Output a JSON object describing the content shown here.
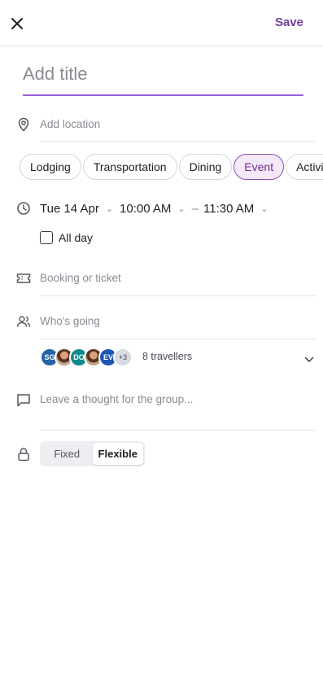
{
  "header": {
    "save_label": "Save"
  },
  "title_input": {
    "placeholder": "Add title",
    "value": ""
  },
  "location": {
    "placeholder": "Add location"
  },
  "categories": [
    {
      "label": "Lodging",
      "selected": false
    },
    {
      "label": "Transportation",
      "selected": false
    },
    {
      "label": "Dining",
      "selected": false
    },
    {
      "label": "Event",
      "selected": true
    },
    {
      "label": "Activity",
      "selected": false
    }
  ],
  "schedule": {
    "date": "Tue 14 Apr",
    "start": "10:00 AM",
    "separator": "–",
    "end": "11:30 AM"
  },
  "all_day": {
    "label": "All day",
    "checked": false
  },
  "booking": {
    "placeholder": "Booking or ticket"
  },
  "attendees": {
    "placeholder": "Who's going",
    "avatars": [
      {
        "initials": "SG",
        "color": "#2563a8"
      },
      {
        "initials": "",
        "color": "#8a5a44",
        "photo": true
      },
      {
        "initials": "DO",
        "color": "#0f8a8a"
      },
      {
        "initials": "",
        "color": "#b9865a",
        "photo": true
      },
      {
        "initials": "EV",
        "color": "#1e57b3"
      }
    ],
    "more_count": "+3",
    "count_label": "8 travellers"
  },
  "comment": {
    "placeholder": "Leave a thought for the group..."
  },
  "timing_mode": {
    "options": [
      "Fixed",
      "Flexible"
    ],
    "selected": "Flexible"
  },
  "colors": {
    "accent": "#6e3fa0",
    "chip_active_bg": "#f4e9f8",
    "underline": "#9b5fd9"
  }
}
